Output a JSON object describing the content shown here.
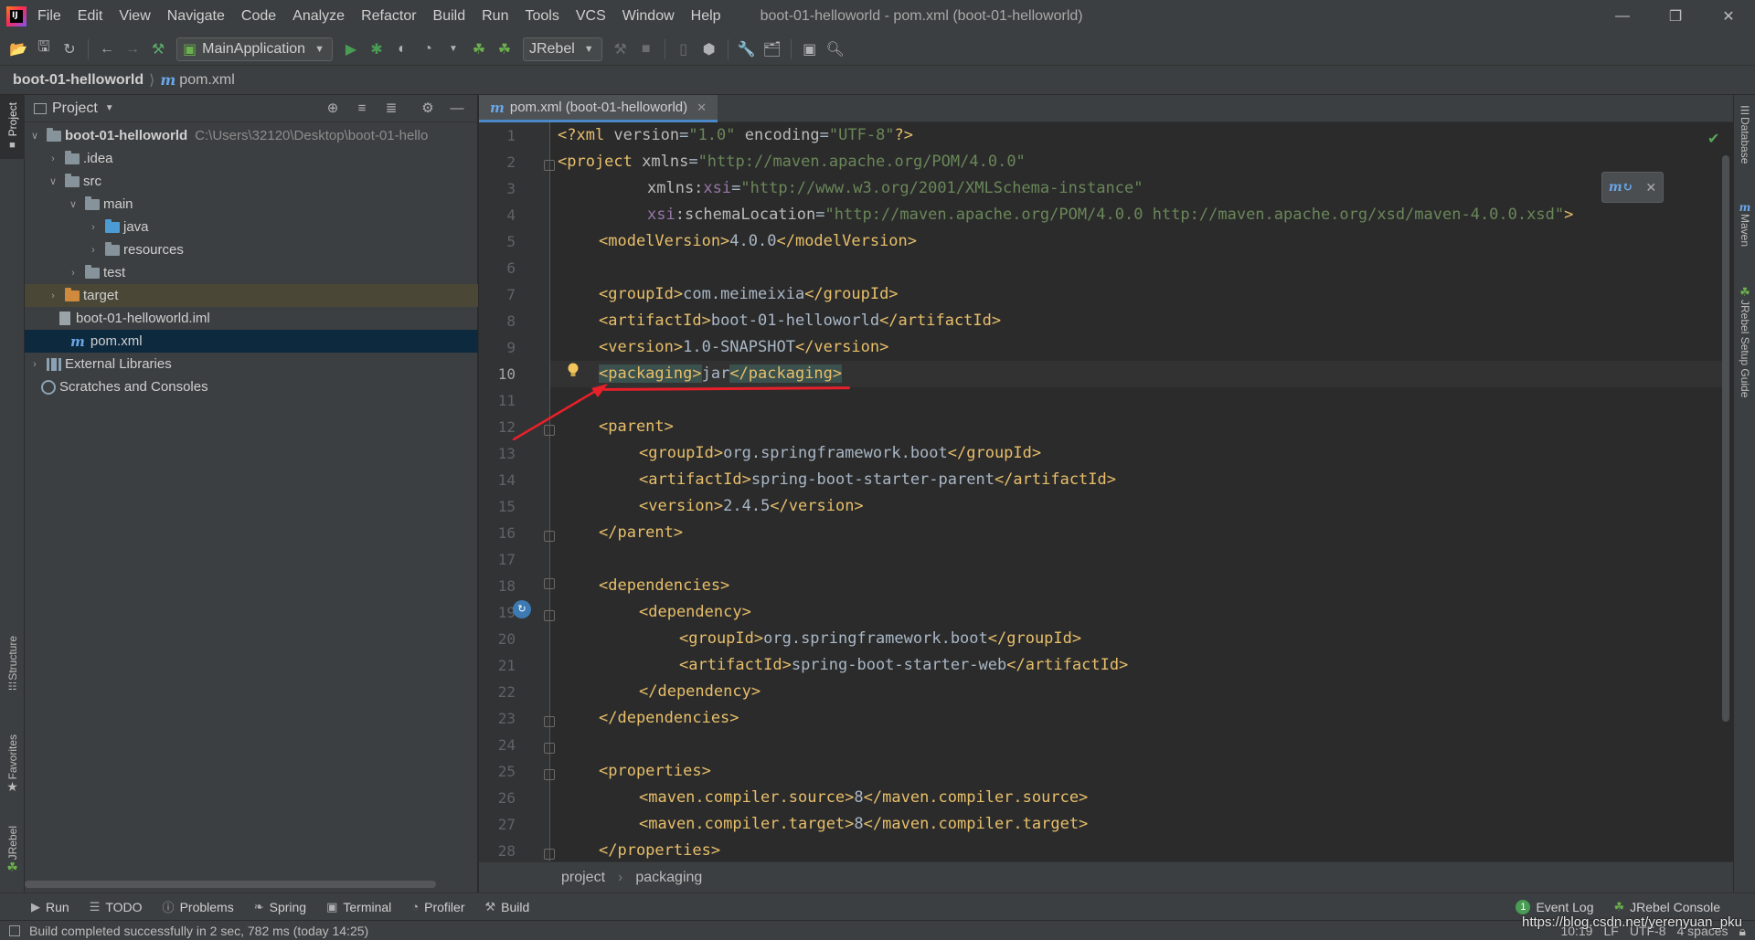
{
  "menubar": {
    "items": [
      "File",
      "Edit",
      "View",
      "Navigate",
      "Code",
      "Analyze",
      "Refactor",
      "Build",
      "Run",
      "Tools",
      "VCS",
      "Window",
      "Help"
    ],
    "title": "boot-01-helloworld - pom.xml (boot-01-helloworld)"
  },
  "toolbar": {
    "run_config": "MainApplication",
    "jrebel_combo": "JRebel"
  },
  "navbar": {
    "project": "boot-01-helloworld",
    "file": "pom.xml"
  },
  "project_panel": {
    "title": "Project",
    "tree": [
      {
        "label": "boot-01-helloworld",
        "path": "C:\\Users\\32120\\Desktop\\boot-01-hello"
      },
      {
        "label": ".idea"
      },
      {
        "label": "src"
      },
      {
        "label": "main"
      },
      {
        "label": "java"
      },
      {
        "label": "resources"
      },
      {
        "label": "test"
      },
      {
        "label": "target"
      },
      {
        "label": "boot-01-helloworld.iml"
      },
      {
        "label": "pom.xml"
      },
      {
        "label": "External Libraries"
      },
      {
        "label": "Scratches and Consoles"
      }
    ]
  },
  "editor": {
    "tab_label": "pom.xml (boot-01-helloworld)",
    "current_line": 10,
    "line_numbers": [
      "1",
      "2",
      "3",
      "4",
      "5",
      "6",
      "7",
      "8",
      "9",
      "10",
      "11",
      "12",
      "13",
      "14",
      "15",
      "16",
      "17",
      "18",
      "19",
      "20",
      "21",
      "22",
      "23",
      "24",
      "25",
      "26",
      "27",
      "28"
    ],
    "breadcrumb": [
      "project",
      "packaging"
    ]
  },
  "code": {
    "l1": {
      "pi_open": "<?xml ",
      "a1": "version",
      "v1": "\"1.0\"",
      "a2": " encoding",
      "v2": "\"UTF-8\"",
      "pi_close": "?>"
    },
    "l2": {
      "tag": "<project ",
      "attr": "xmlns",
      "val": "\"http://maven.apache.org/POM/4.0.0\""
    },
    "l3": {
      "attr": "xmlns:",
      "ns": "xsi",
      "val": "\"http://www.w3.org/2001/XMLSchema-instance\""
    },
    "l4": {
      "ns": "xsi",
      "attr": ":schemaLocation",
      "val": "\"http://maven.apache.org/POM/4.0.0 http://maven.apache.org/xsd/maven-4.0.0.xsd\"",
      "close": ">"
    },
    "l5": {
      "open": "<modelVersion>",
      "text": "4.0.0",
      "close": "</modelVersion>"
    },
    "l7": {
      "open": "<groupId>",
      "text": "com.meimeixia",
      "close": "</groupId>"
    },
    "l8": {
      "open": "<artifactId>",
      "text": "boot-01-helloworld",
      "close": "</artifactId>"
    },
    "l9": {
      "open": "<version>",
      "text": "1.0-SNAPSHOT",
      "close": "</version>"
    },
    "l10": {
      "open": "<packaging>",
      "text": "jar",
      "close": "</packaging>"
    },
    "l12": {
      "open": "<parent>"
    },
    "l13": {
      "open": "<groupId>",
      "text": "org.springframework.boot",
      "close": "</groupId>"
    },
    "l14": {
      "open": "<artifactId>",
      "text": "spring-boot-starter-parent",
      "close": "</artifactId>"
    },
    "l15": {
      "open": "<version>",
      "text": "2.4.5",
      "close": "</version>"
    },
    "l16": {
      "close": "</parent>"
    },
    "l18": {
      "open": "<dependencies>"
    },
    "l19": {
      "open": "<dependency>"
    },
    "l20": {
      "open": "<groupId>",
      "text": "org.springframework.boot",
      "close": "</groupId>"
    },
    "l21": {
      "open": "<artifactId>",
      "text": "spring-boot-starter-web",
      "close": "</artifactId>"
    },
    "l22": {
      "close": "</dependency>"
    },
    "l23": {
      "close": "</dependencies>"
    },
    "l25": {
      "open": "<properties>"
    },
    "l26": {
      "open": "<maven.compiler.source>",
      "text": "8",
      "close": "</maven.compiler.source>"
    },
    "l27": {
      "open": "<maven.compiler.target>",
      "text": "8",
      "close": "</maven.compiler.target>"
    },
    "l28": {
      "close": "</properties>"
    }
  },
  "left_stripe": {
    "project": "Project",
    "structure": "Structure",
    "favorites": "Favorites",
    "jrebel": "JRebel"
  },
  "right_stripe": {
    "database": "Database",
    "maven": "Maven",
    "jrebel_guide": "JRebel Setup Guide"
  },
  "bottom_tools": {
    "run": "Run",
    "todo": "TODO",
    "problems": "Problems",
    "spring": "Spring",
    "terminal": "Terminal",
    "profiler": "Profiler",
    "build": "Build",
    "event_log_count": "1",
    "event_log": "Event Log",
    "jrebel_console": "JRebel Console"
  },
  "statusbar": {
    "message": "Build completed successfully in 2 sec, 782 ms (today 14:25)",
    "position": "10:19",
    "line_sep": "LF",
    "encoding": "UTF-8",
    "indent": "4 spaces"
  },
  "watermark": "https://blog.csdn.net/yerenyuan_pku",
  "colors": {
    "tag": "#e8bf6a",
    "attr_value": "#6a8759",
    "namespace": "#9876aa",
    "text": "#a9b7c6",
    "annotation_red": "#e8202a",
    "selection": "#0d293e"
  }
}
